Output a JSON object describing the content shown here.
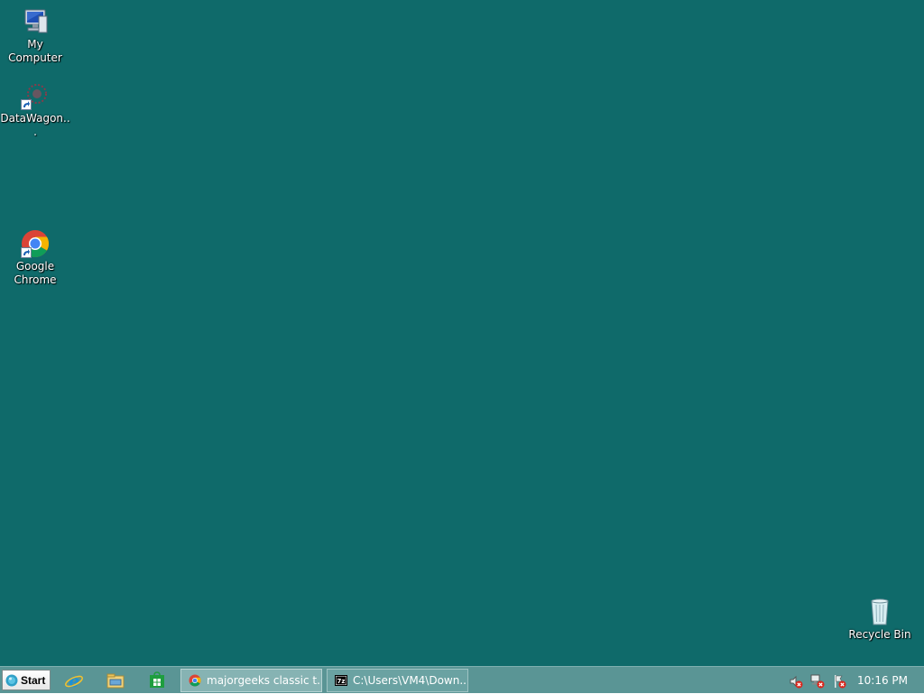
{
  "desktop": {
    "background_color": "#0f6a6a",
    "icons": [
      {
        "label": "My Computer",
        "icon": "my-computer-icon"
      },
      {
        "label": "DataWagon...",
        "icon": "datawagon-icon"
      },
      {
        "label": "Google Chrome",
        "icon": "chrome-icon"
      },
      {
        "label": "Recycle Bin",
        "icon": "recycle-bin-icon"
      }
    ]
  },
  "taskbar": {
    "start_label": "Start",
    "quick_launch": [
      {
        "icon": "internet-explorer-icon"
      },
      {
        "icon": "file-explorer-icon"
      },
      {
        "icon": "windows-store-icon"
      }
    ],
    "tasks": [
      {
        "label": "majorgeeks classic t...",
        "icon": "chrome-icon"
      },
      {
        "label": "C:\\Users\\VM4\\Down...",
        "icon": "7zip-icon"
      }
    ],
    "tray": [
      {
        "icon": "volume-muted-icon"
      },
      {
        "icon": "network-disconnected-icon"
      },
      {
        "icon": "action-center-alert-icon"
      }
    ],
    "clock": "10:16 PM"
  }
}
